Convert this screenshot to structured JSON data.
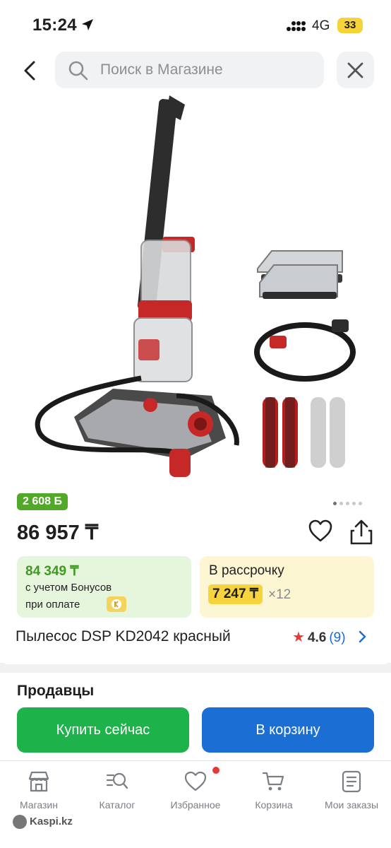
{
  "status_bar": {
    "time": "15:24",
    "network": "4G",
    "battery": "33"
  },
  "header": {
    "search_placeholder": "Поиск в Магазине"
  },
  "product": {
    "bonus_badge": "2 608 Б",
    "price": "86 957 ₸",
    "bonus_card": {
      "amount": "84 349 ₸",
      "line1": "с учетом Бонусов",
      "line2": "при оплате"
    },
    "installment_card": {
      "title": "В рассрочку",
      "monthly": "7 247 ₸",
      "months": "×12"
    },
    "name": "Пылесос DSP KD2042 красный",
    "rating": {
      "value": "4.6",
      "count": "(9)"
    },
    "image_pages": 5,
    "active_image": 1
  },
  "sellers": {
    "title": "Продавцы"
  },
  "actions": {
    "buy_now": "Купить сейчас",
    "add_to_cart": "В корзину"
  },
  "nav": {
    "items": [
      {
        "label": "Магазин",
        "icon": "store-icon"
      },
      {
        "label": "Каталог",
        "icon": "catalog-search-icon"
      },
      {
        "label": "Избранное",
        "icon": "heart-icon"
      },
      {
        "label": "Корзина",
        "icon": "cart-icon"
      },
      {
        "label": "Мои заказы",
        "icon": "orders-icon"
      }
    ]
  },
  "watermark": "Kaspi.kz",
  "colors": {
    "green": "#1db24a",
    "blue": "#1a6ed4",
    "accent_red": "#e53935",
    "bonus_green": "#52a829"
  }
}
